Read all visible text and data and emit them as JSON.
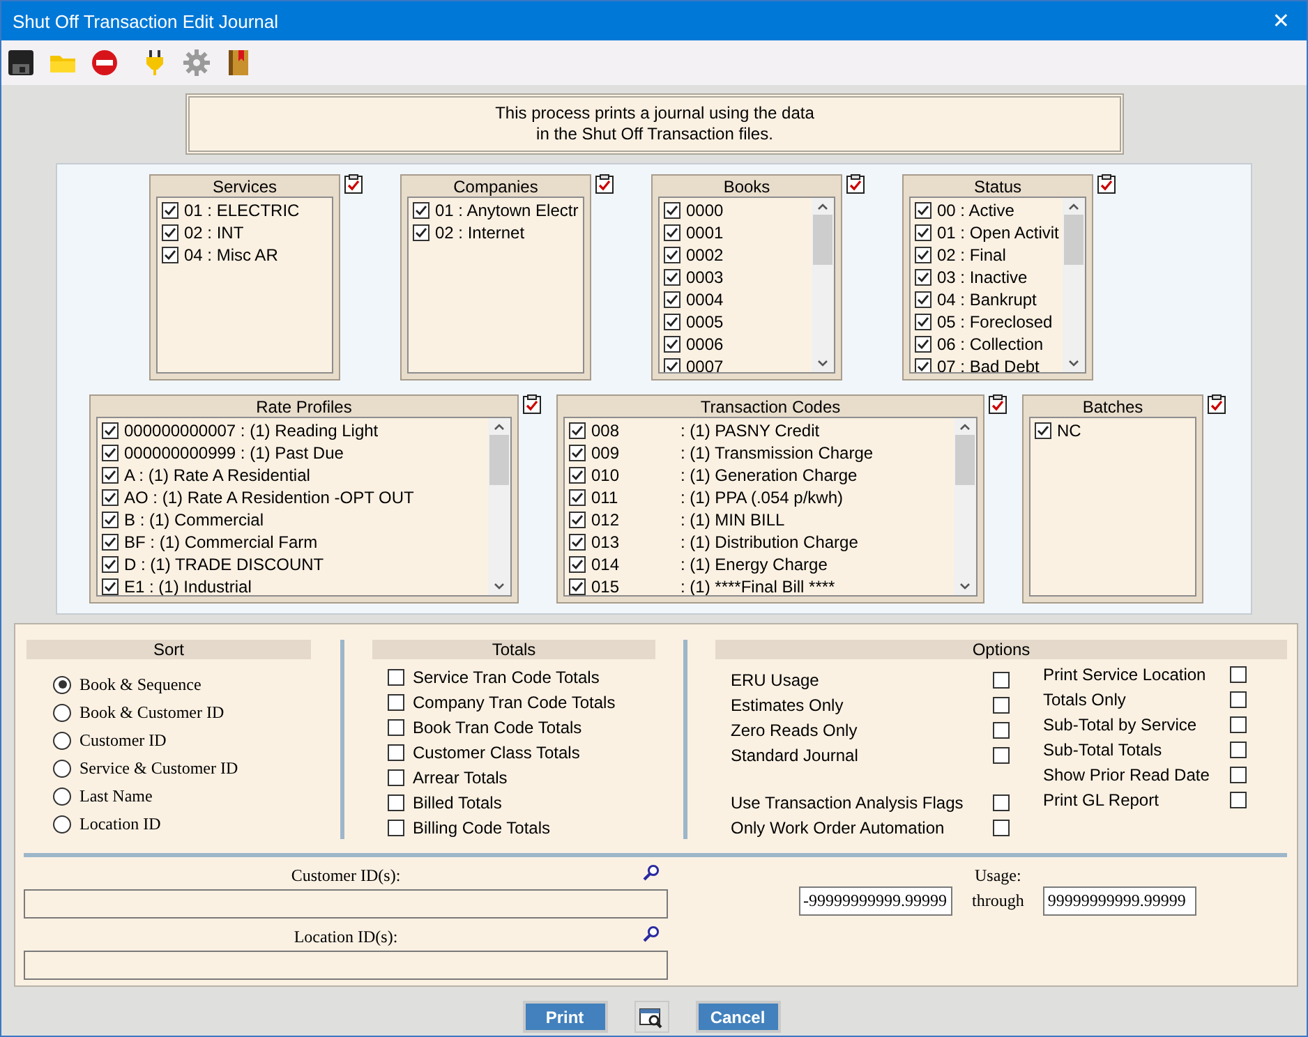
{
  "window": {
    "title": "Shut Off Transaction Edit Journal",
    "close": "✕"
  },
  "message": "This process prints a journal using the data\nin the Shut Off Transaction files.",
  "filter_rows": [
    [
      {
        "title": "Services",
        "scrollbar": false,
        "items": [
          {
            "label": "01 : ELECTRIC",
            "checked": true
          },
          {
            "label": "02 : INT",
            "checked": true
          },
          {
            "label": "04 : Misc AR",
            "checked": true
          }
        ]
      },
      {
        "title": "Companies",
        "scrollbar": false,
        "items": [
          {
            "label": "01 : Anytown Electr",
            "checked": true
          },
          {
            "label": "02 : Internet",
            "checked": true
          }
        ]
      },
      {
        "title": "Books",
        "scrollbar": true,
        "items": [
          {
            "label": "0000",
            "checked": true
          },
          {
            "label": "0001",
            "checked": true
          },
          {
            "label": "0002",
            "checked": true
          },
          {
            "label": "0003",
            "checked": true
          },
          {
            "label": "0004",
            "checked": true
          },
          {
            "label": "0005",
            "checked": true
          },
          {
            "label": "0006",
            "checked": true
          },
          {
            "label": "0007",
            "checked": true
          }
        ]
      },
      {
        "title": "Status",
        "scrollbar": true,
        "items": [
          {
            "label": "00 : Active",
            "checked": true
          },
          {
            "label": "01 : Open Activit",
            "checked": true
          },
          {
            "label": "02 : Final",
            "checked": true
          },
          {
            "label": "03 : Inactive",
            "checked": true
          },
          {
            "label": "04 : Bankrupt",
            "checked": true
          },
          {
            "label": "05 : Foreclosed",
            "checked": true
          },
          {
            "label": "06 : Collection",
            "checked": true
          },
          {
            "label": "07 : Bad Debt",
            "checked": true
          }
        ]
      }
    ],
    [
      {
        "title": "Rate Profiles",
        "scrollbar": true,
        "items": [
          {
            "label": "000000000007 : (1) Reading Light",
            "checked": true
          },
          {
            "label": "000000000999 : (1) Past Due",
            "checked": true
          },
          {
            "label": "A : (1) Rate A Residential",
            "checked": true
          },
          {
            "label": "AO : (1) Rate A Residention -OPT OUT",
            "checked": true
          },
          {
            "label": "B : (1) Commercial",
            "checked": true
          },
          {
            "label": "BF : (1) Commercial Farm",
            "checked": true
          },
          {
            "label": "D : (1) TRADE DISCOUNT",
            "checked": true
          },
          {
            "label": "E1 : (1) Industrial",
            "checked": true
          }
        ]
      },
      {
        "title": "Transaction Codes",
        "scrollbar": true,
        "items": [
          {
            "code": "008",
            "label": ": (1) PASNY Credit",
            "checked": true
          },
          {
            "code": "009",
            "label": ": (1) Transmission Charge",
            "checked": true
          },
          {
            "code": "010",
            "label": ": (1) Generation Charge",
            "checked": true
          },
          {
            "code": "011",
            "label": ": (1) PPA (.054 p/kwh)",
            "checked": true
          },
          {
            "code": "012",
            "label": ": (1) MIN BILL",
            "checked": true
          },
          {
            "code": "013",
            "label": ": (1) Distribution Charge",
            "checked": true
          },
          {
            "code": "014",
            "label": ": (1) Energy Charge",
            "checked": true
          },
          {
            "code": "015",
            "label": ": (1) ****Final Bill ****",
            "checked": true
          }
        ]
      },
      {
        "title": "Batches",
        "scrollbar": false,
        "items": [
          {
            "label": "NC",
            "checked": true
          }
        ]
      }
    ]
  ],
  "sort": {
    "title": "Sort",
    "options": [
      {
        "label": "Book & Sequence",
        "selected": true
      },
      {
        "label": "Book & Customer ID",
        "selected": false
      },
      {
        "label": "Customer ID",
        "selected": false
      },
      {
        "label": "Service & Customer ID",
        "selected": false
      },
      {
        "label": "Last Name",
        "selected": false
      },
      {
        "label": "Location ID",
        "selected": false
      }
    ]
  },
  "totals": {
    "title": "Totals",
    "items": [
      {
        "label": "Service Tran Code Totals",
        "checked": false
      },
      {
        "label": "Company Tran Code Totals",
        "checked": false
      },
      {
        "label": "Book Tran Code Totals",
        "checked": false
      },
      {
        "label": "Customer Class Totals",
        "checked": false
      },
      {
        "label": "Arrear Totals",
        "checked": false
      },
      {
        "label": "Billed Totals",
        "checked": false
      },
      {
        "label": "Billing Code Totals",
        "checked": false
      }
    ]
  },
  "options": {
    "title": "Options",
    "left_groups": [
      [
        {
          "label": "ERU Usage",
          "checked": false
        },
        {
          "label": "Estimates Only",
          "checked": false
        },
        {
          "label": "Zero Reads Only",
          "checked": false
        },
        {
          "label": "Standard Journal",
          "checked": false
        }
      ],
      [
        {
          "label": "Use Transaction Analysis Flags",
          "checked": false
        },
        {
          "label": "Only Work Order Automation",
          "checked": false
        }
      ]
    ],
    "right": [
      {
        "label": "Print Service Location",
        "checked": false
      },
      {
        "label": "Totals Only",
        "checked": false
      },
      {
        "label": "Sub-Total by Service",
        "checked": false
      },
      {
        "label": "Sub-Total Totals",
        "checked": false
      },
      {
        "label": "Show Prior Read Date",
        "checked": false
      },
      {
        "label": "Print GL Report",
        "checked": false
      }
    ]
  },
  "customer_ids": {
    "label": "Customer ID(s):"
  },
  "location_ids": {
    "label": "Location ID(s):"
  },
  "usage": {
    "label": "Usage:",
    "from": "-99999999999.99999",
    "through": "through",
    "to": "99999999999.99999"
  },
  "buttons": {
    "print": "Print",
    "cancel": "Cancel"
  }
}
